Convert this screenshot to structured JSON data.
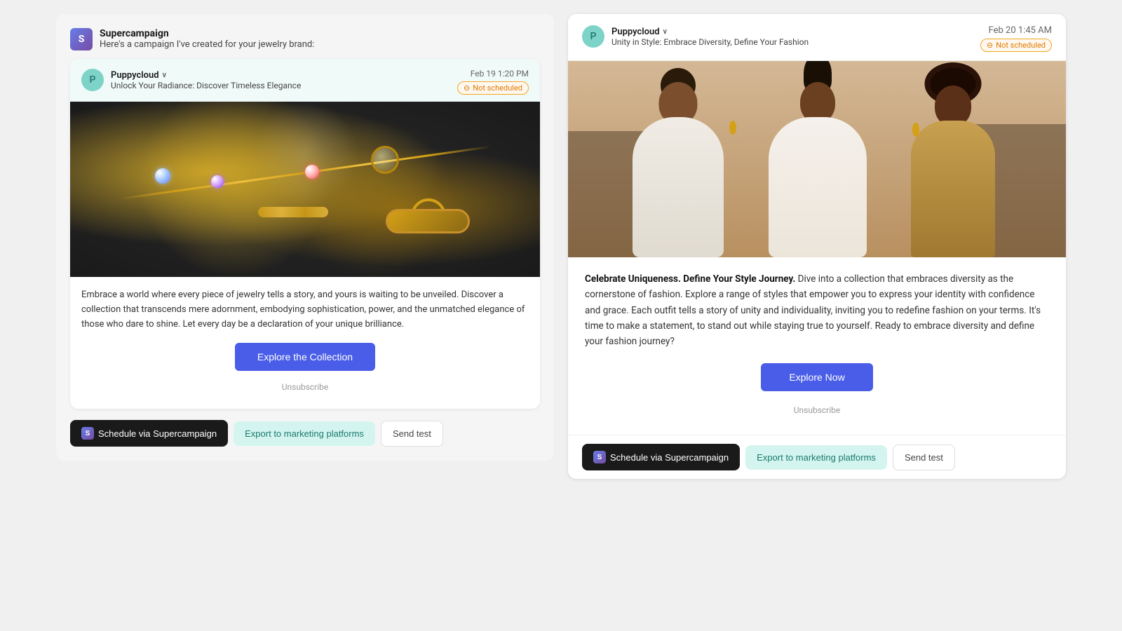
{
  "app": {
    "brand": "Supercampaign",
    "intro": "Here's a campaign I've created for your jewelry brand:"
  },
  "campaign_left": {
    "sender": {
      "initial": "P",
      "name": "Puppycloud",
      "name_with_chevron": "Puppycloud ∨"
    },
    "subject": "Unlock Your Radiance: Discover Timeless Elegance",
    "date": "Feb 19 1:20 PM",
    "status": "Not scheduled",
    "body": "Embrace a world where every piece of jewelry tells a story, and yours is waiting to be unveiled. Discover a collection that transcends mere adornment, embodying sophistication, power, and the unmatched elegance of those who dare to shine. Let every day be a declaration of your unique brilliance.",
    "cta_label": "Explore the Collection",
    "unsubscribe_label": "Unsubscribe"
  },
  "campaign_right": {
    "sender": {
      "initial": "P",
      "name": "Puppycloud",
      "name_with_chevron": "Puppycloud ∨"
    },
    "subject": "Unity in Style: Embrace Diversity, Define Your Fashion",
    "date": "Feb 20 1:45 AM",
    "status": "Not scheduled",
    "body_bold": "Celebrate Uniqueness. Define Your Style Journey.",
    "body_rest": " Dive into a collection that embraces diversity as the cornerstone of fashion. Explore a range of styles that empower you to express your identity with confidence and grace. Each outfit tells a story of unity and individuality, inviting you to redefine fashion on your terms. It's time to make a statement, to stand out while staying true to yourself. Ready to embrace diversity and define your fashion journey?",
    "cta_label": "Explore Now",
    "unsubscribe_label": "Unsubscribe"
  },
  "actions": {
    "schedule_label": "Schedule via",
    "schedule_brand": "Supercampaign",
    "export_label": "Export to marketing platforms",
    "send_test_label": "Send test"
  }
}
